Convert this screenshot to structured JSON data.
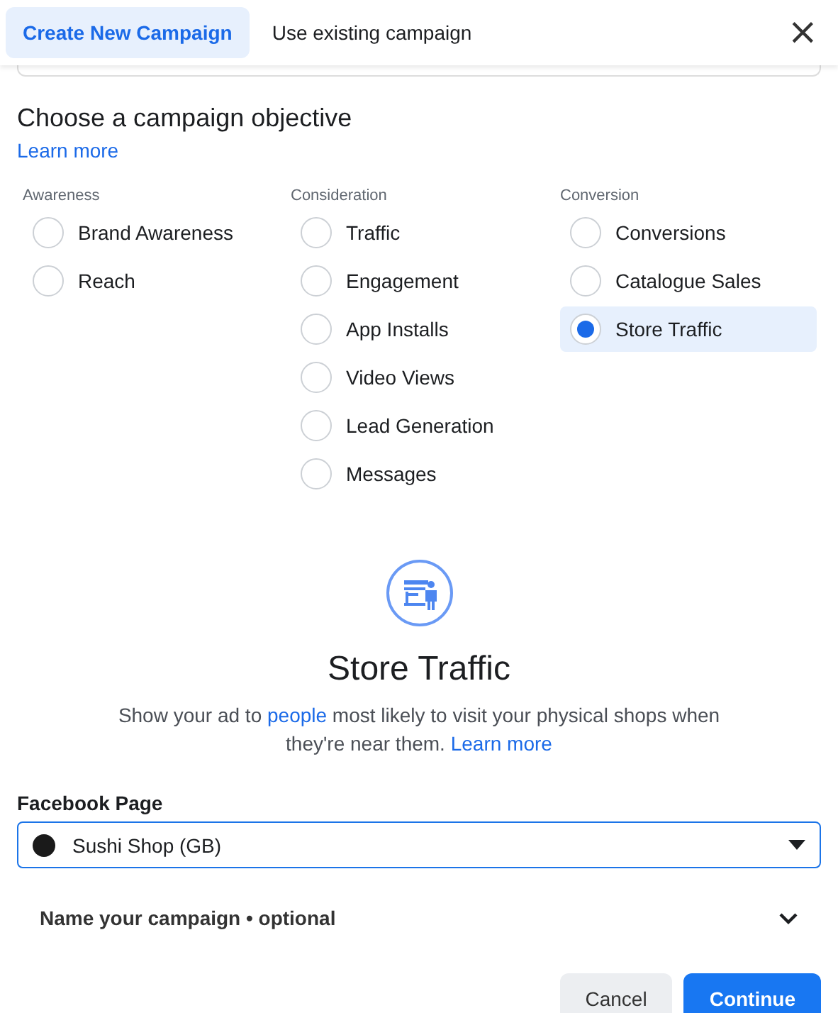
{
  "tabs": [
    {
      "label": "Create New Campaign",
      "selected": true
    },
    {
      "label": "Use existing campaign",
      "selected": false
    }
  ],
  "close": "×",
  "heading": "Choose a campaign objective",
  "heading_link": "Learn more",
  "objective_groups": [
    {
      "label": "Awareness",
      "options": [
        {
          "label": "Brand Awareness",
          "selected": false
        },
        {
          "label": "Reach",
          "selected": false
        }
      ]
    },
    {
      "label": "Consideration",
      "options": [
        {
          "label": "Traffic",
          "selected": false
        },
        {
          "label": "Engagement",
          "selected": false
        },
        {
          "label": "App Installs",
          "selected": false
        },
        {
          "label": "Video Views",
          "selected": false
        },
        {
          "label": "Lead Generation",
          "selected": false
        },
        {
          "label": "Messages",
          "selected": false
        }
      ]
    },
    {
      "label": "Conversion",
      "options": [
        {
          "label": "Conversions",
          "selected": false
        },
        {
          "label": "Catalogue Sales",
          "selected": false
        },
        {
          "label": "Store Traffic",
          "selected": true
        }
      ]
    }
  ],
  "detail": {
    "title": "Store Traffic",
    "text_1": "Show your ad to",
    "link_1": "people",
    "text_2": "most likely to visit your physical shops when they're near them.",
    "link_2": "Learn more"
  },
  "facebook_page": {
    "label": "Facebook Page",
    "value": "Sushi Shop (GB)"
  },
  "name_section": {
    "label": "Name your campaign • optional",
    "expanded": false
  },
  "buttons": [
    {
      "label": "Cancel",
      "kind": "secondary"
    },
    {
      "label": "Continue",
      "kind": "primary"
    }
  ]
}
